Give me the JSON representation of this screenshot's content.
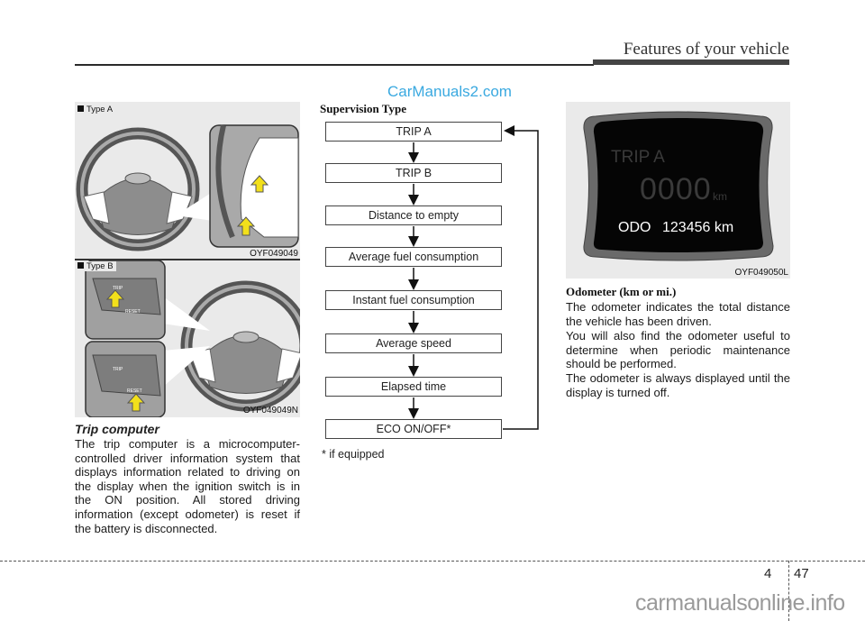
{
  "header": {
    "title": "Features of your vehicle"
  },
  "watermarks": {
    "top": "CarManuals2.com",
    "bottom": "carmanualsonline.info"
  },
  "figures": {
    "type_a": {
      "label": "Type A",
      "code": "OYF049049",
      "button_labels": [
        "TRIP",
        "RESET"
      ]
    },
    "type_b": {
      "label": "Type B",
      "code": "OYF049049N",
      "button_labels": [
        "TRIP",
        "RESET"
      ]
    },
    "cluster": {
      "code": "OYF049050L",
      "display": {
        "mode": "TRIP A",
        "trip_value": "0000",
        "trip_unit": "km",
        "odo_label": "ODO",
        "odo_value": "123456 km"
      }
    }
  },
  "trip_computer": {
    "title": "Trip computer",
    "body": "The trip computer is a microcomputer-controlled driver information system that displays information related to driving on the display when the ignition switch is in the ON position. All stored driving information (except odometer) is reset if the battery is disconnected."
  },
  "supervision": {
    "title": "Supervision Type",
    "steps": [
      "TRIP A",
      "TRIP B",
      "Distance to empty",
      "Average fuel consumption",
      "Instant fuel consumption",
      "Average speed",
      "Elapsed time",
      "ECO ON/OFF*"
    ],
    "footnote": "* if equipped"
  },
  "odometer": {
    "title": "Odometer (km or mi.)",
    "paragraphs": [
      "The odometer indicates the total distance the vehicle has been driven.",
      "You will also find the odometer useful to determine when periodic maintenance should be performed.",
      "The odometer is always displayed until the display is turned off."
    ]
  },
  "footer": {
    "chapter": "4",
    "page": "47"
  }
}
